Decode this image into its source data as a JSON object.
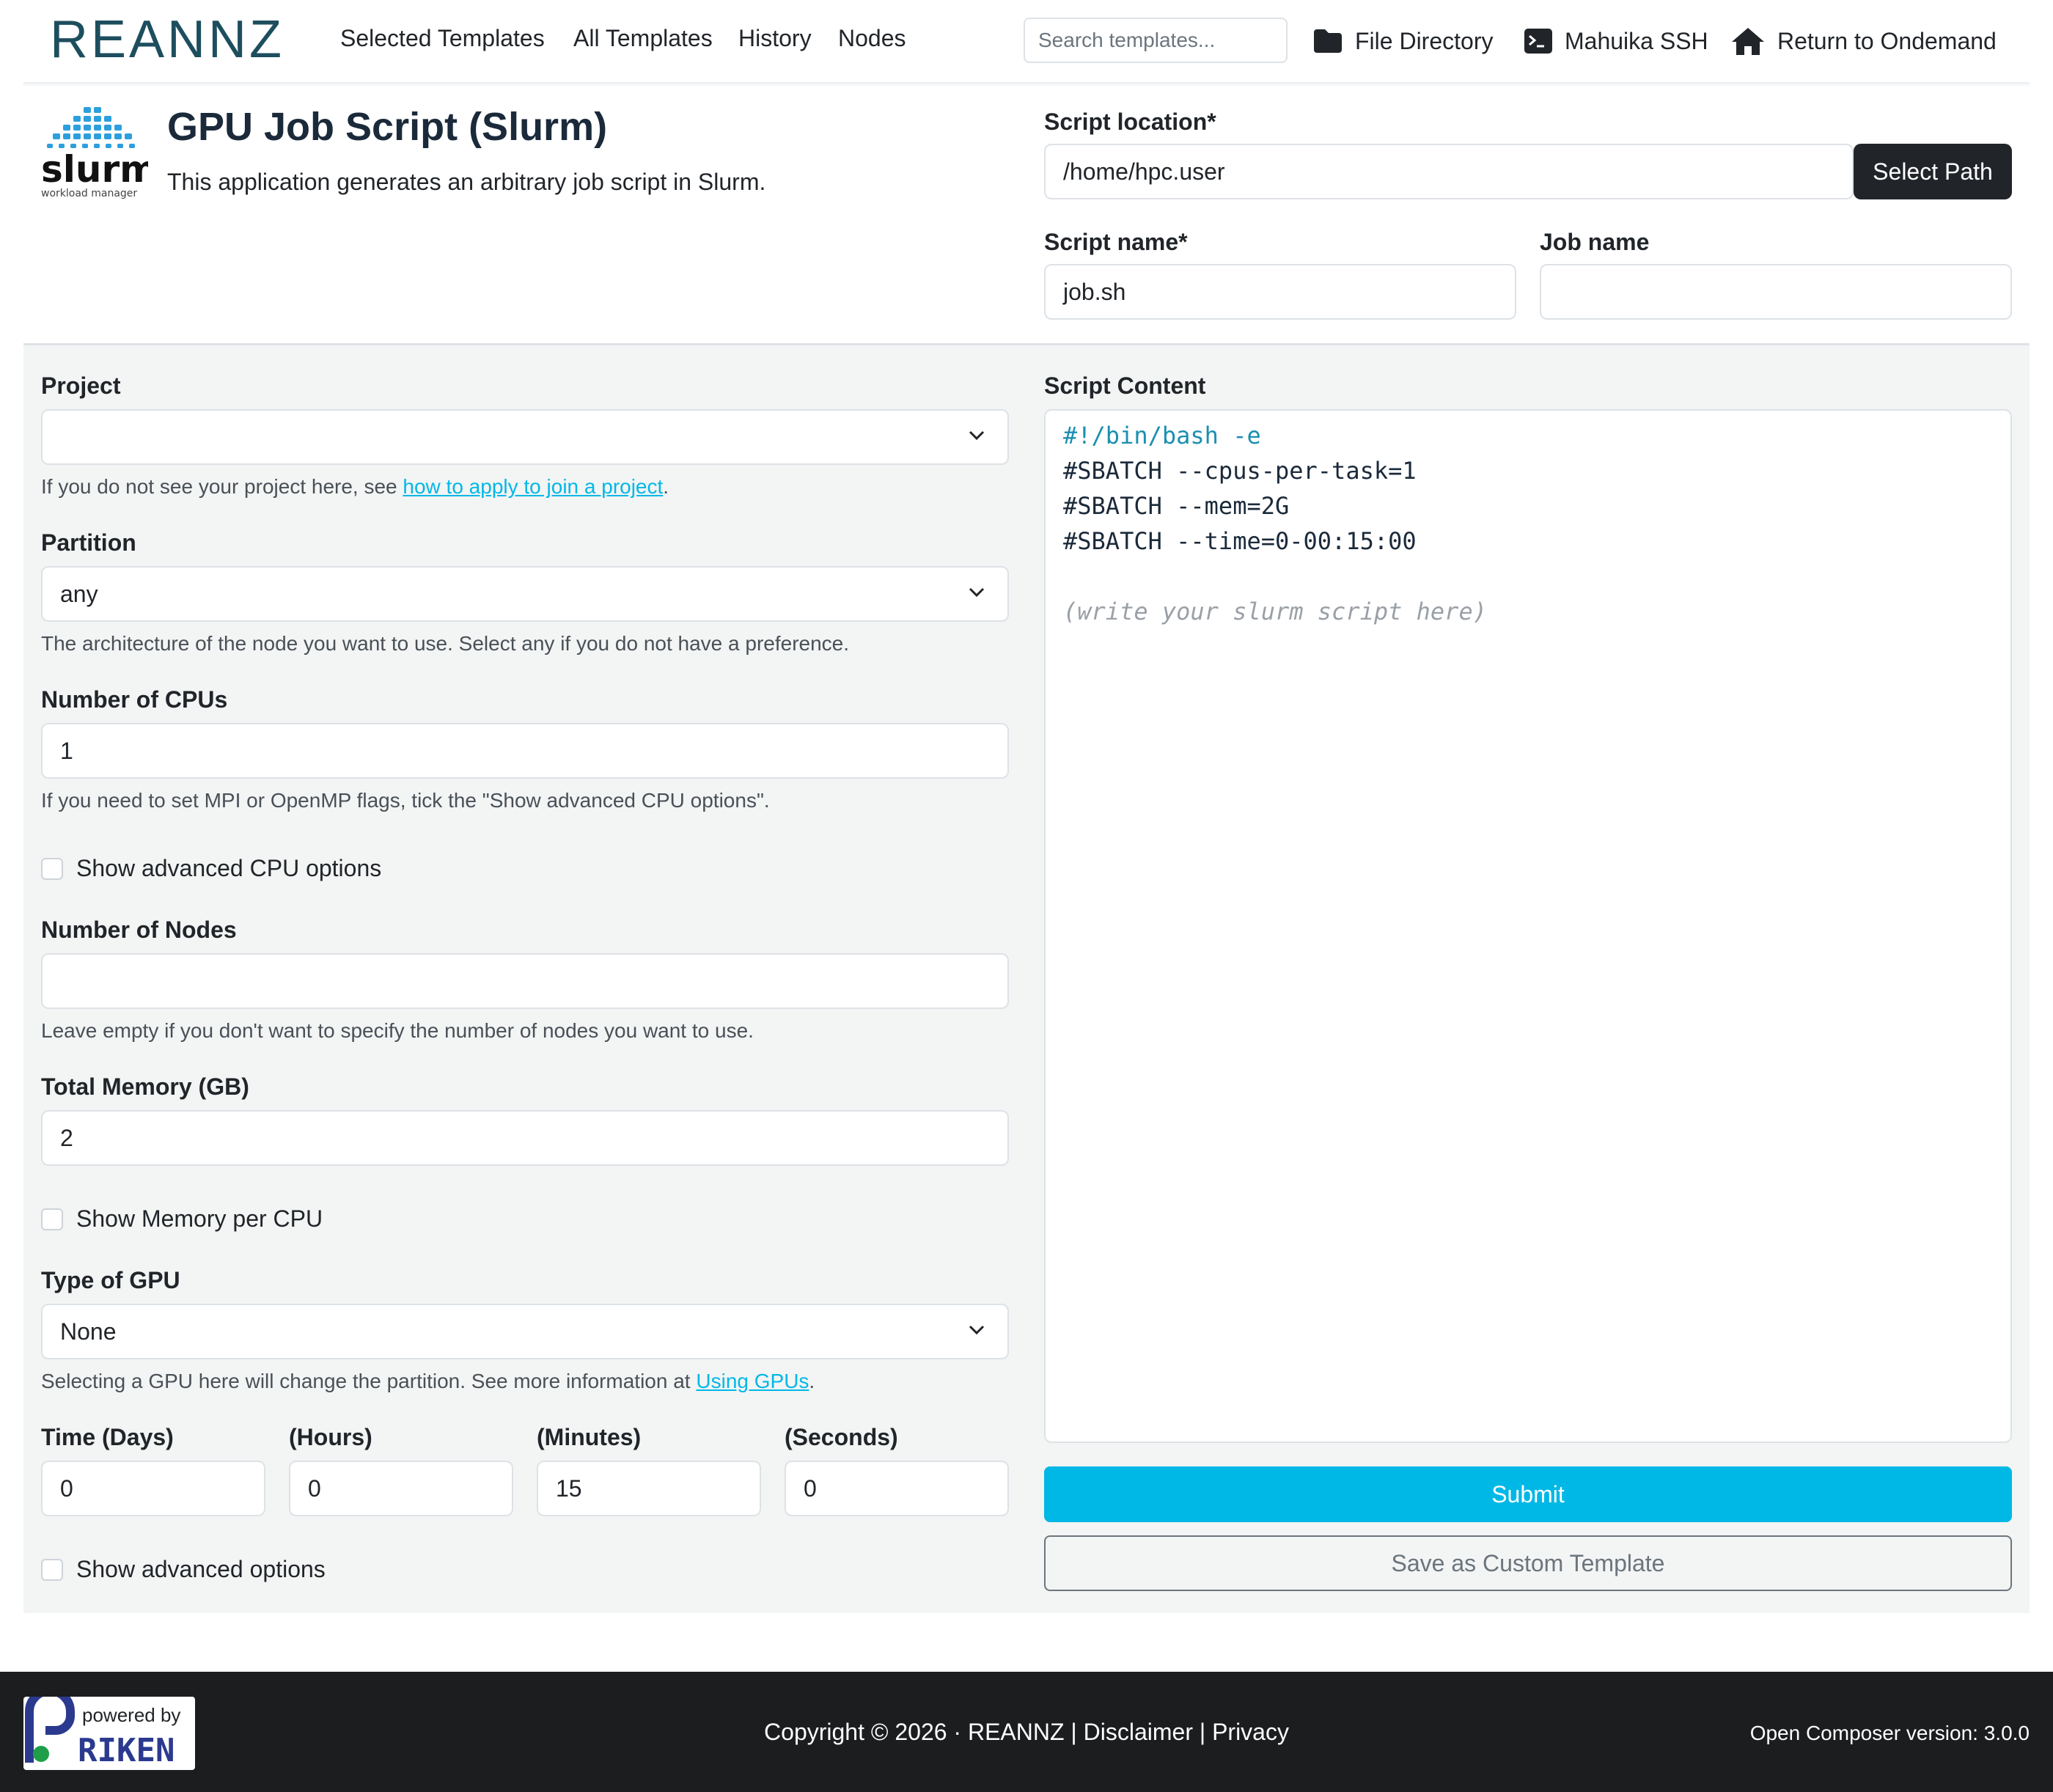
{
  "navbar": {
    "brand": "REANNZ",
    "links": [
      "Selected Templates",
      "All Templates",
      "History",
      "Nodes"
    ],
    "search_placeholder": "Search templates...",
    "file_directory": "File Directory",
    "ssh": "Mahuika SSH",
    "return": "Return to Ondemand"
  },
  "app": {
    "logo_text": "slurm",
    "logo_subtext": "workload manager",
    "title": "GPU Job Script (Slurm)",
    "description": "This application generates an arbitrary job script in Slurm."
  },
  "script_location": {
    "label": "Script location*",
    "value": "/home/hpc.user",
    "button": "Select Path"
  },
  "script_name": {
    "label": "Script name*",
    "value": "job.sh"
  },
  "job_name": {
    "label": "Job name",
    "value": ""
  },
  "form": {
    "project": {
      "label": "Project",
      "value": "",
      "help_prefix": "If you do not see your project here, see ",
      "help_link": "how to apply to join a project",
      "help_suffix": "."
    },
    "partition": {
      "label": "Partition",
      "value": "any",
      "help": "The architecture of the node you want to use. Select any if you do not have a preference."
    },
    "cpus": {
      "label": "Number of CPUs",
      "value": "1",
      "help": "If you need to set MPI or OpenMP flags, tick the \"Show advanced CPU options\"."
    },
    "advanced_cpu": {
      "label": "Show advanced CPU options",
      "checked": false
    },
    "nodes": {
      "label": "Number of Nodes",
      "value": "",
      "help": "Leave empty if you don't want to specify the number of nodes you want to use."
    },
    "memory": {
      "label": "Total Memory (GB)",
      "value": "2"
    },
    "memory_per_cpu": {
      "label": "Show Memory per CPU",
      "checked": false
    },
    "gpu": {
      "label": "Type of GPU",
      "value": "None",
      "help_prefix": "Selecting a GPU here will change the partition. See more information at ",
      "help_link": "Using GPUs",
      "help_suffix": "."
    },
    "time": {
      "days_label": "Time (Days)",
      "days": "0",
      "hours_label": "(Hours)",
      "hours": "0",
      "minutes_label": "(Minutes)",
      "minutes": "15",
      "seconds_label": "(Seconds)",
      "seconds": "0"
    },
    "advanced": {
      "label": "Show advanced options",
      "checked": false
    }
  },
  "script": {
    "label": "Script Content",
    "lines": [
      "#!/bin/bash -e",
      "#SBATCH --cpus-per-task=1",
      "#SBATCH --mem=2G",
      "#SBATCH --time=0-00:15:00",
      "",
      "(write your slurm script here)"
    ]
  },
  "buttons": {
    "submit": "Submit",
    "save_template": "Save as Custom Template"
  },
  "footer": {
    "powered_by": "powered by",
    "riken": "RIKEN",
    "copyright": "Copyright © 2026 · REANNZ",
    "disclaimer": "Disclaimer",
    "privacy": "Privacy",
    "separator": " | ",
    "version": "Open Composer version: 3.0.0"
  },
  "colors": {
    "accent": "#00b8e6",
    "dark": "#212529",
    "footer_bg": "#1b1d1f",
    "form_bg": "#f3f4f4"
  }
}
